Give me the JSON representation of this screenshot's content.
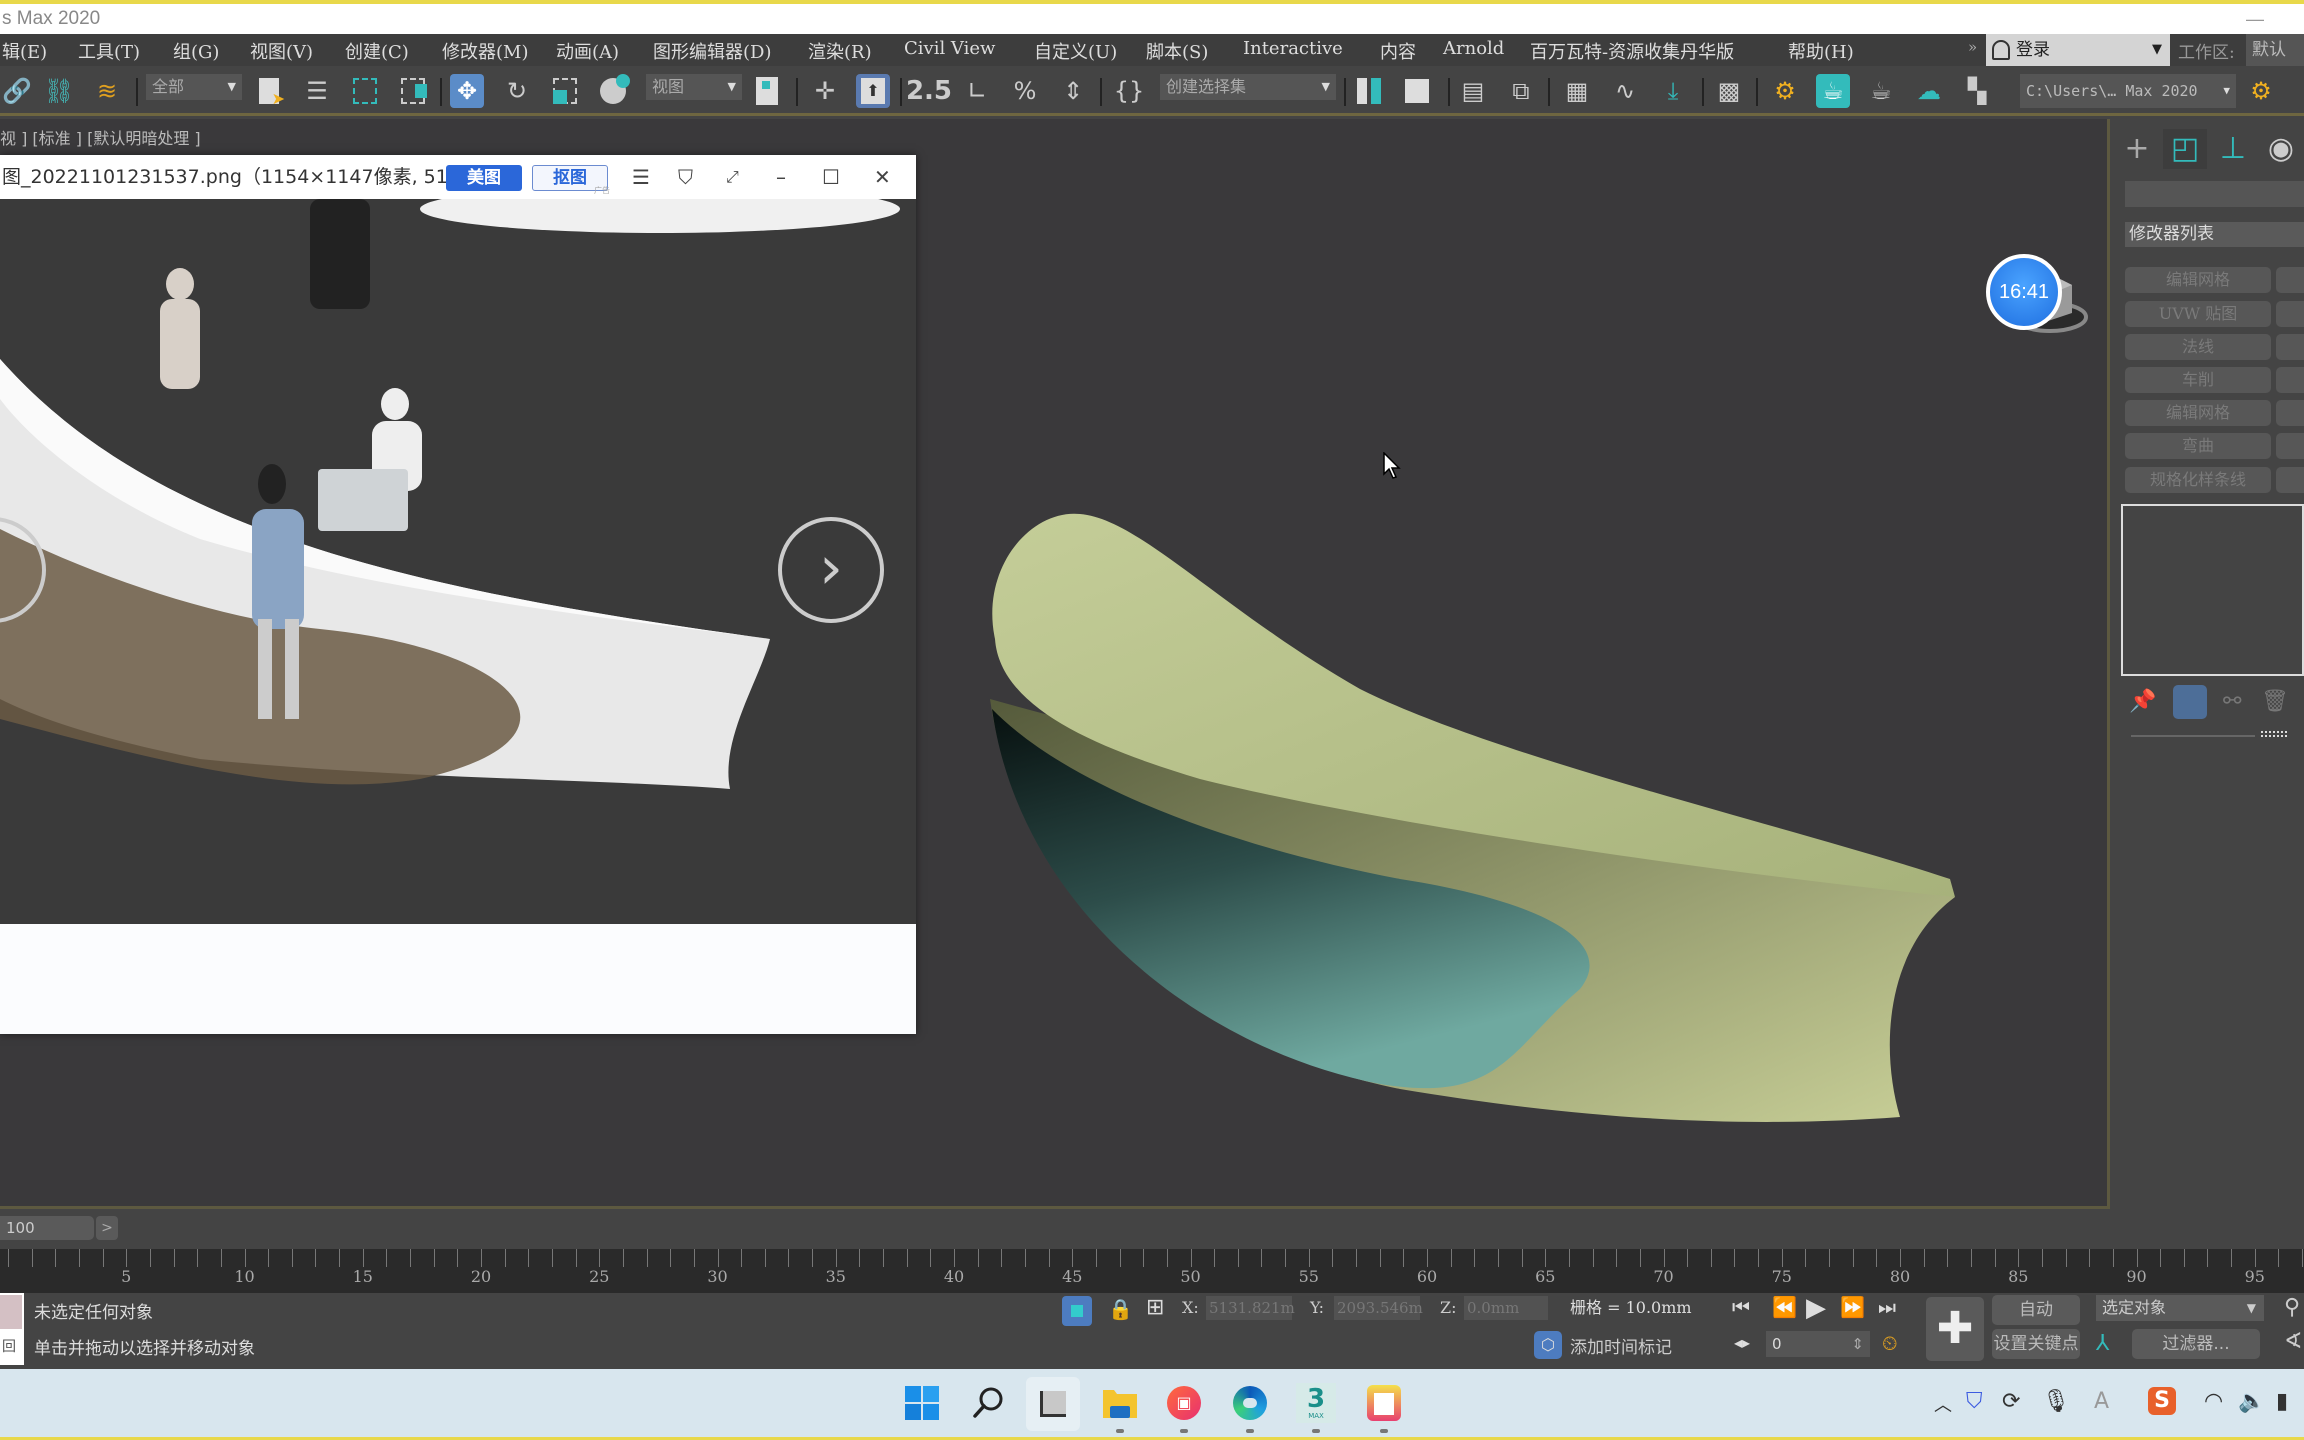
{
  "app": {
    "title": "s Max 2020",
    "minimize": "—"
  },
  "menubar": {
    "items": [
      {
        "label": "辑(E)"
      },
      {
        "label": "工具(T)"
      },
      {
        "label": "组(G)"
      },
      {
        "label": "视图(V)"
      },
      {
        "label": "创建(C)"
      },
      {
        "label": "修改器(M)"
      },
      {
        "label": "动画(A)"
      },
      {
        "label": "图形编辑器(D)"
      },
      {
        "label": "渲染(R)"
      },
      {
        "label": "Civil View"
      },
      {
        "label": "自定义(U)"
      },
      {
        "label": "脚本(S)"
      },
      {
        "label": "Interactive"
      },
      {
        "label": "内容"
      },
      {
        "label": "Arnold"
      },
      {
        "label": "百万瓦特-资源收集丹华版"
      },
      {
        "label": "帮助(H)"
      }
    ],
    "overflow": "»",
    "login": "登录",
    "workspace_label": "工作区:",
    "workspace_value": "默认"
  },
  "toolbar": {
    "selection_filter": "全部",
    "ref_coord": "视图",
    "named_selection": "创建选择集",
    "project_path": "C:\\Users\\… Max 2020",
    "snap_label": "2.5"
  },
  "viewport": {
    "label": "视 ] [标准 ] [默认明暗处理 ]",
    "clock": "16:41",
    "object_colors": {
      "top": "#b2bd86",
      "front": "#4a7c78",
      "side": "#9aa36a"
    }
  },
  "image_viewer": {
    "title": "图_20221101231537.png（1154×1147像素, 512...",
    "meitu_button": "美图",
    "koutu_button": "抠图",
    "ad_label": "广告",
    "menu_icon": "☰",
    "prev_icon": "‹",
    "next_icon": "›"
  },
  "command_panel": {
    "modifier_list_label": "修改器列表",
    "buttons": [
      "编辑网格",
      "UVW 贴图",
      "法线",
      "车削",
      "编辑网格",
      "弯曲",
      "规格化样条线"
    ]
  },
  "timeslider": {
    "frame": "100",
    "next": ">"
  },
  "ruler": {
    "labels": [
      5,
      10,
      15,
      20,
      25,
      30,
      35,
      40,
      45,
      50,
      55,
      60,
      65,
      70,
      75,
      80,
      85,
      90,
      95
    ]
  },
  "status": {
    "line1": "未选定任何对象",
    "line2": "单击并拖动以选择并移动对象",
    "maxscript_glyph": "回",
    "x_label": "X:",
    "x_value": "5131.821m",
    "y_label": "Y:",
    "y_value": "2093.546m",
    "z_label": "Z:",
    "z_value": "0.0mm",
    "grid": "栅格 = 10.0mm",
    "add_time_tag": "添加时间标记",
    "auto_key": "自动",
    "set_key": "设置关键点",
    "selected_object": "选定对象",
    "filters": "过滤器...",
    "current_frame": "0"
  },
  "taskbar": {
    "apps": [
      "start",
      "search",
      "task-view",
      "file-explorer",
      "screen-recorder",
      "edge",
      "3ds-max",
      "notepad"
    ],
    "max_label": "3",
    "max_sub": "MAX"
  }
}
